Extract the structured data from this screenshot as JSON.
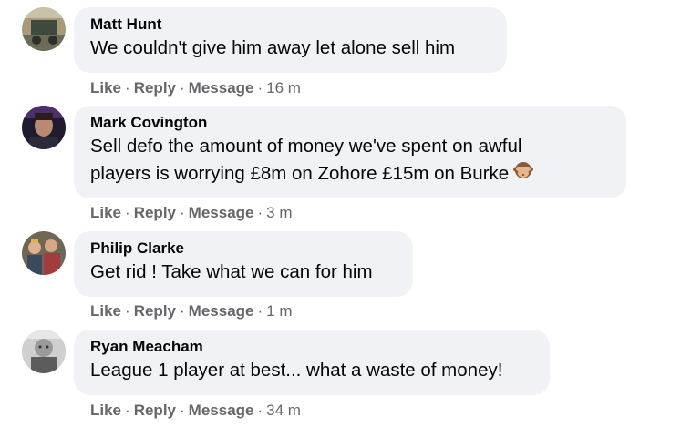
{
  "comments": [
    {
      "author": "Matt Hunt",
      "lines": [
        "We couldn't give him away let alone sell him"
      ],
      "actions": {
        "like": "Like",
        "reply": "Reply",
        "message": "Message"
      },
      "time": "16 m"
    },
    {
      "author": "Mark Covington",
      "lines": [
        "Sell defo the amount of money we've spent on awful",
        "players is worrying £8m on Zohore £15m on Burke"
      ],
      "emoji": "see-no-evil-monkey-icon",
      "actions": {
        "like": "Like",
        "reply": "Reply",
        "message": "Message"
      },
      "time": "3 m"
    },
    {
      "author": "Philip Clarke",
      "lines": [
        "Get rid ! Take what we can for him"
      ],
      "actions": {
        "like": "Like",
        "reply": "Reply",
        "message": "Message"
      },
      "time": "1 m"
    },
    {
      "author": "Ryan Meacham",
      "lines": [
        "League 1 player at best... what a waste of money!"
      ],
      "actions": {
        "like": "Like",
        "reply": "Reply",
        "message": "Message"
      },
      "time": "34 m"
    }
  ],
  "separator": "·",
  "colors": {
    "bubble": "#f0f2f5",
    "name": "#050505",
    "meta": "#65676b"
  }
}
